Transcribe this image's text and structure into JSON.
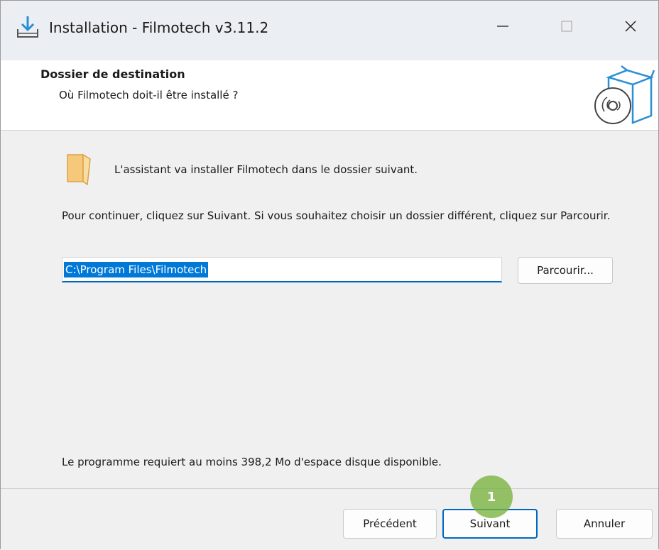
{
  "window": {
    "title": "Installation - Filmotech v3.11.2",
    "controls": {
      "minimize": "—",
      "maximize": "☐",
      "close": "✕"
    }
  },
  "header": {
    "title": "Dossier de destination",
    "subtitle": "Où Filmotech doit-il être installé ?"
  },
  "content": {
    "intro": "L'assistant va installer Filmotech dans le dossier suivant.",
    "instructions": "Pour continuer, cliquez sur Suivant. Si vous souhaitez choisir un dossier différent, cliquez sur Parcourir.",
    "path": "C:\\Program Files\\Filmotech",
    "browse_label": "Parcourir...",
    "space_required": "Le programme requiert au moins 398,2 Mo d'espace disque disponible."
  },
  "footer": {
    "prev_label": "Précédent",
    "next_label": "Suivant",
    "cancel_label": "Annuler"
  },
  "annotation": {
    "step": "1"
  },
  "colors": {
    "accent": "#0067c0",
    "selection": "#0078d7",
    "folder": "#f5c87a",
    "badge": "#78b23c",
    "box_line": "#2b8fd6"
  },
  "icons": {
    "title": "download-install-icon",
    "folder": "folder-icon",
    "header_art": "software-box-disc-icon"
  }
}
